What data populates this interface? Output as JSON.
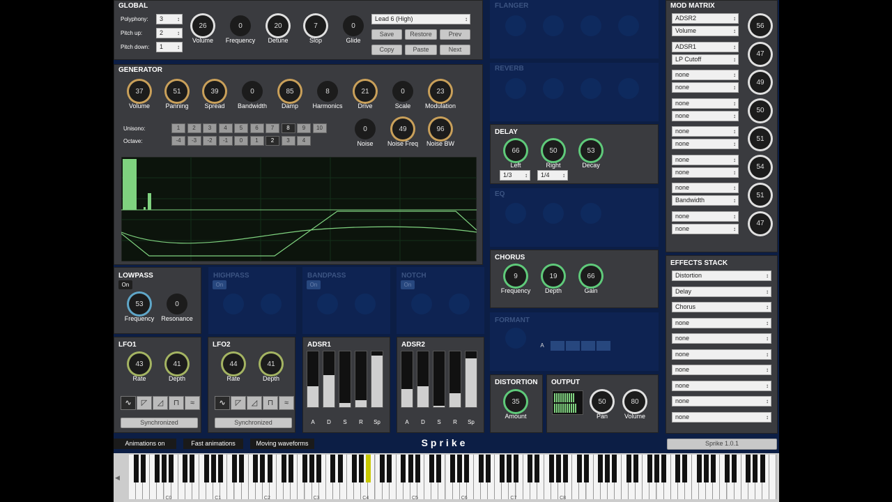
{
  "global": {
    "title": "GLOBAL",
    "polyphony_label": "Polyphony:",
    "polyphony": "3",
    "pitchup_label": "Pitch up:",
    "pitchup": "2",
    "pitchdown_label": "Pitch down:",
    "pitchdown": "1",
    "knobs": [
      {
        "label": "Volume",
        "value": "26"
      },
      {
        "label": "Frequency",
        "value": "0"
      },
      {
        "label": "Detune",
        "value": "20"
      },
      {
        "label": "Slop",
        "value": "7"
      },
      {
        "label": "Glide",
        "value": "0"
      }
    ],
    "preset": "Lead 6 (High)",
    "buttons": [
      "Save",
      "Restore",
      "Prev",
      "Copy",
      "Paste",
      "Next"
    ]
  },
  "generator": {
    "title": "GENERATOR",
    "knobs": [
      {
        "label": "Volume",
        "value": "37"
      },
      {
        "label": "Panning",
        "value": "51"
      },
      {
        "label": "Spread",
        "value": "39"
      },
      {
        "label": "Bandwidth",
        "value": "0"
      },
      {
        "label": "Damp",
        "value": "85"
      },
      {
        "label": "Harmonics",
        "value": "8"
      },
      {
        "label": "Drive",
        "value": "21"
      },
      {
        "label": "Scale",
        "value": "0"
      },
      {
        "label": "Modulation",
        "value": "23"
      }
    ],
    "unisono_label": "Unisono:",
    "unisono": [
      "1",
      "2",
      "3",
      "4",
      "5",
      "6",
      "7",
      "8",
      "9",
      "10"
    ],
    "unisono_selected": "8",
    "octave_label": "Octave:",
    "octave": [
      "-4",
      "-3",
      "-2",
      "-1",
      "0",
      "1",
      "2",
      "3",
      "4"
    ],
    "octave_selected": "2",
    "noise_knobs": [
      {
        "label": "Noise",
        "value": "0"
      },
      {
        "label": "Noise Freq",
        "value": "49"
      },
      {
        "label": "Noise BW",
        "value": "96"
      }
    ]
  },
  "lowpass": {
    "title": "LOWPASS",
    "on": "On",
    "knobs": [
      {
        "label": "Frequency",
        "value": "53"
      },
      {
        "label": "Resonance",
        "value": "0"
      }
    ]
  },
  "highpass": {
    "title": "HIGHPASS",
    "on": "On"
  },
  "bandpass": {
    "title": "BANDPASS",
    "on": "On"
  },
  "notch": {
    "title": "NOTCH",
    "on": "On"
  },
  "lfo1": {
    "title": "LFO1",
    "knobs": [
      {
        "label": "Rate",
        "value": "43"
      },
      {
        "label": "Depth",
        "value": "41"
      }
    ],
    "sync": "Synchronized"
  },
  "lfo2": {
    "title": "LFO2",
    "knobs": [
      {
        "label": "Rate",
        "value": "44"
      },
      {
        "label": "Depth",
        "value": "41"
      }
    ],
    "sync": "Synchronized"
  },
  "adsr1": {
    "title": "ADSR1",
    "labels": [
      "A",
      "D",
      "S",
      "R",
      "Sp"
    ],
    "levels": [
      0.38,
      0.58,
      0.08,
      0.12,
      0.92
    ]
  },
  "adsr2": {
    "title": "ADSR2",
    "labels": [
      "A",
      "D",
      "S",
      "R",
      "Sp"
    ],
    "levels": [
      0.32,
      0.38,
      0.02,
      0.25,
      0.88
    ]
  },
  "flanger": {
    "title": "FLANGER"
  },
  "reverb": {
    "title": "REVERB"
  },
  "delay": {
    "title": "DELAY",
    "knobs": [
      {
        "label": "Left",
        "value": "66"
      },
      {
        "label": "Right",
        "value": "50"
      },
      {
        "label": "Decay",
        "value": "53"
      }
    ],
    "left_div": "1/3",
    "right_div": "1/4"
  },
  "eq": {
    "title": "EQ"
  },
  "chorus": {
    "title": "CHORUS",
    "knobs": [
      {
        "label": "Frequency",
        "value": "9"
      },
      {
        "label": "Depth",
        "value": "19"
      },
      {
        "label": "Gain",
        "value": "66"
      }
    ]
  },
  "formant": {
    "title": "FORMANT",
    "vowel": "A"
  },
  "distortion": {
    "title": "DISTORTION",
    "knobs": [
      {
        "label": "Amount",
        "value": "35"
      }
    ]
  },
  "output": {
    "title": "OUTPUT",
    "knobs": [
      {
        "label": "Pan",
        "value": "50"
      },
      {
        "label": "Volume",
        "value": "80"
      }
    ]
  },
  "modmatrix": {
    "title": "MOD MATRIX",
    "rows": [
      {
        "src": "ADSR2",
        "dst": "Volume",
        "amt": "56"
      },
      {
        "src": "ADSR1",
        "dst": "LP Cutoff",
        "amt": "47"
      },
      {
        "src": "none",
        "dst": "none",
        "amt": "49"
      },
      {
        "src": "none",
        "dst": "none",
        "amt": "50"
      },
      {
        "src": "none",
        "dst": "none",
        "amt": "51"
      },
      {
        "src": "none",
        "dst": "none",
        "amt": "54"
      },
      {
        "src": "none",
        "dst": "Bandwidth",
        "amt": "51"
      },
      {
        "src": "none",
        "dst": "none",
        "amt": "47"
      }
    ]
  },
  "effects": {
    "title": "EFFECTS STACK",
    "items": [
      "Distortion",
      "Delay",
      "Chorus",
      "none",
      "none",
      "none",
      "none",
      "none",
      "none",
      "none"
    ]
  },
  "footer": {
    "anim": "Animations on",
    "fast": "Fast animations",
    "moving": "Moving waveforms",
    "brand": "Sprike",
    "version": "Sprike 1.0.1"
  },
  "octaves": [
    "C0",
    "C1",
    "C2",
    "C3",
    "C4",
    "C5",
    "C6",
    "C7",
    "C8"
  ]
}
